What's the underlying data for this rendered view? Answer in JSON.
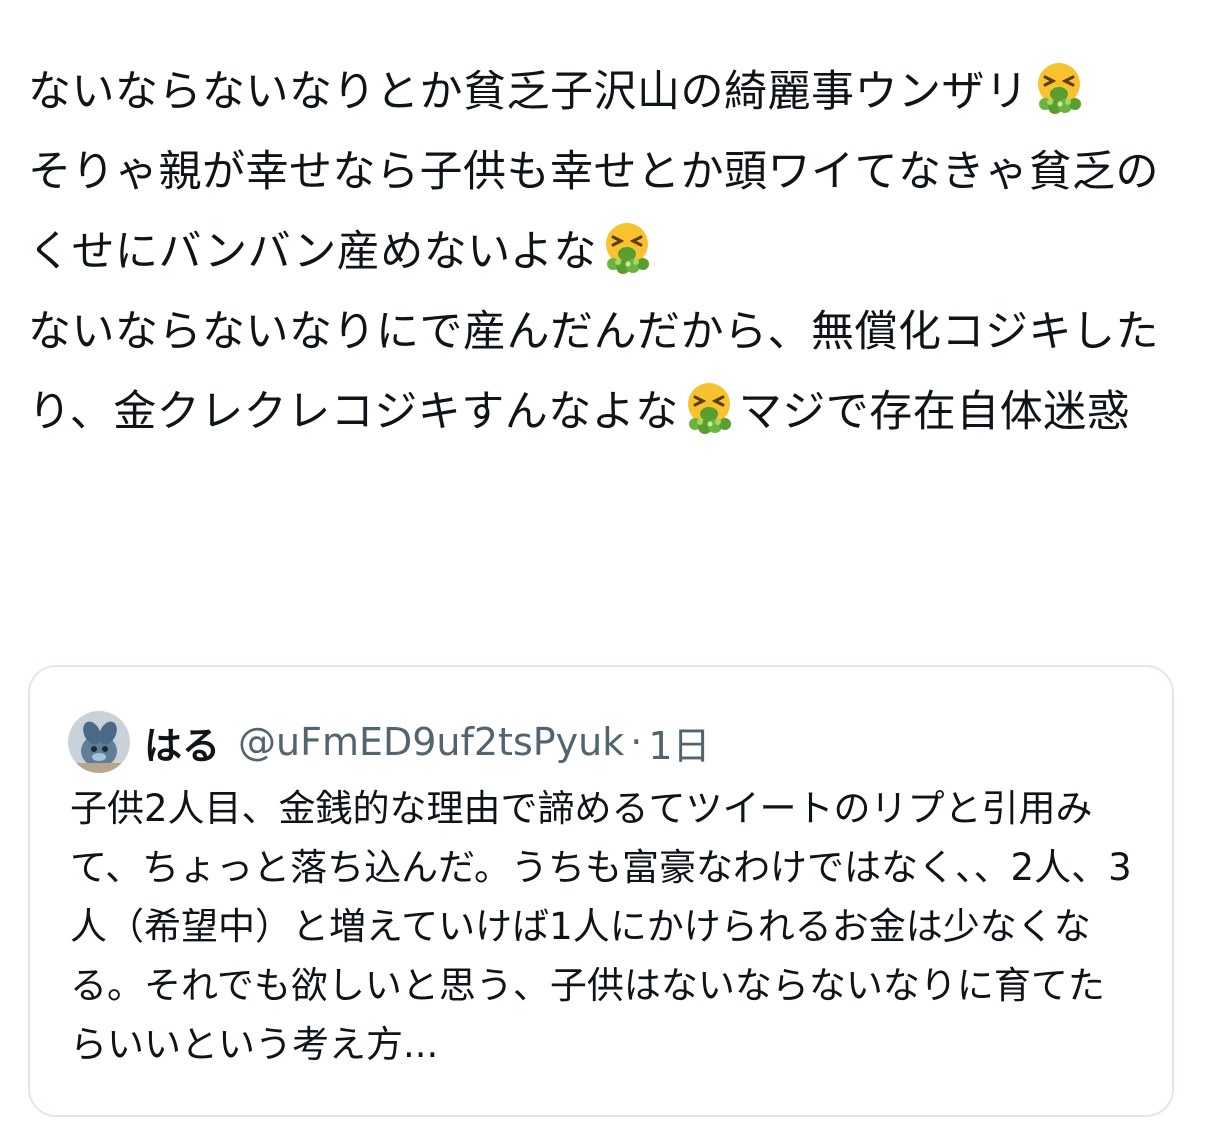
{
  "tweet": {
    "text_1": "ないならないなりとか貧乏子沢山の綺麗事ウンザリ",
    "text_2": "そりゃ親が幸せなら子供も幸せとか頭ワイてなきゃ貧乏のくせにバンバン産めないよな",
    "text_3": "ないならないなりにで産んだんだから、無償化コジキしたり、金クレクレコジキすんなよな",
    "text_4": "マジで存在自体迷惑",
    "emoji_icon": "nauseated-vomiting-face-icon"
  },
  "quote": {
    "name": "はる",
    "handle": "@uFmED9uf2tsPyuk",
    "separator": "·",
    "time": "1日",
    "text": "子供2人目、金銭的な理由で諦めるてツイートのリプと引用みて、ちょっと落ち込んだ。うちも富豪なわけではなく、、2人、3人（希望中）と増えていけば1人にかけられるお金は少なくなる。それでも欲しいと思う、子供はないならないなりに育てたらいいという考え方..."
  },
  "colors": {
    "text": "#0f1419",
    "secondary": "#536471",
    "border": "#e1e8ed"
  }
}
